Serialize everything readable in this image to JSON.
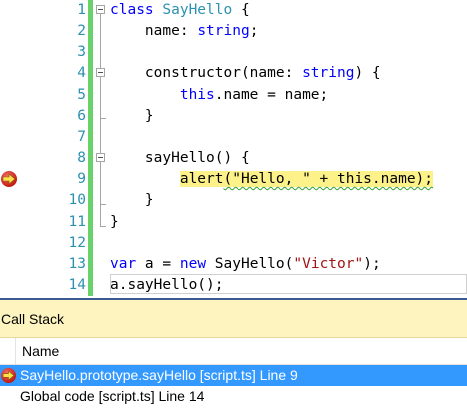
{
  "editor": {
    "line_numbers": [
      "1",
      "2",
      "3",
      "4",
      "5",
      "6",
      "7",
      "8",
      "9",
      "10",
      "11",
      "12",
      "13",
      "14"
    ],
    "code": {
      "l1": {
        "kw": "class",
        "name": "SayHello",
        "rest": " {"
      },
      "l2": {
        "prefix": "    name: ",
        "type": "string",
        "rest": ";"
      },
      "l4": {
        "prefix": "    constructor(name: ",
        "type": "string",
        "rest": ") {"
      },
      "l5": {
        "indent": "        ",
        "kw": "this",
        "rest": ".name = name;"
      },
      "l6": {
        "text": "    }"
      },
      "l8": {
        "text": "    sayHello() {"
      },
      "l9": {
        "indent": "        ",
        "part1": "alert",
        "part2": "(\"Hello, \" + this.name);"
      },
      "l10": {
        "text": "    }"
      },
      "l11": {
        "text": "}"
      },
      "l13": {
        "kw1": "var",
        "mid1": " a = ",
        "kw2": "new",
        "mid2": " SayHello(",
        "str": "\"Victor\"",
        "rest": ");"
      },
      "l14": {
        "text": "a.sayHello();"
      }
    },
    "breakpoint_line": "9",
    "colors": {
      "keyword": "#0000ff",
      "type": "#2b91af",
      "string": "#a31515",
      "line_number": "#2b91af",
      "highlight": "#fdf28a",
      "change_bar": "#6ad26a"
    }
  },
  "callstack": {
    "title": "Call Stack",
    "column_name": "Name",
    "rows": [
      {
        "label": "SayHello.prototype.sayHello [script.ts] Line 9",
        "selected": true
      },
      {
        "label": "Global code [script.ts] Line 14",
        "selected": false
      }
    ],
    "colors": {
      "title_bg": "#fdf4bf",
      "selected_bg": "#3399ff"
    }
  },
  "icons": {
    "breakpoint": "current-statement-arrow-icon",
    "fold": "collapse-minus-icon"
  }
}
